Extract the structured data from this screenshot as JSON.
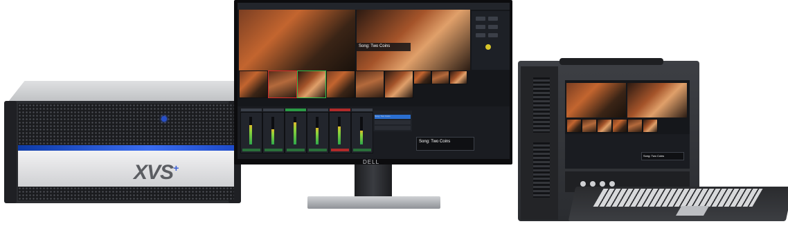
{
  "server": {
    "logo_text": "XVS",
    "logo_mark": "+"
  },
  "monitor": {
    "brand": "DELL"
  },
  "screen": {
    "lower_third_title": "Song: Two Coins",
    "title_preview": "Song: Two Coins",
    "playlist": [
      "Song: Two Coins"
    ]
  },
  "portable": {
    "lower_third_title": "Song: Two Coins"
  },
  "colors": {
    "accent_blue": "#2b6fd1",
    "tally_red": "#d42a2a",
    "tally_green": "#2fbf4a"
  }
}
